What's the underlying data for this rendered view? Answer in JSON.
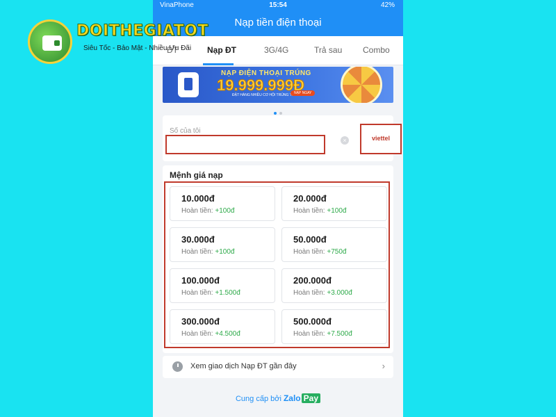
{
  "logo": {
    "brand": "DOITHEGIATOT",
    "slogan": "Siêu Tốc - Bảo Mật - Nhiều Ưu Đãi"
  },
  "status_bar": {
    "carrier": "VinaPhone",
    "time": "15:54",
    "battery": "42%"
  },
  "header": {
    "title": "Nạp tiền điện thoại"
  },
  "tabs": [
    {
      "label": "ĐT",
      "active": false
    },
    {
      "label": "Nạp ĐT",
      "active": true
    },
    {
      "label": "3G/4G",
      "active": false
    },
    {
      "label": "Trả sau",
      "active": false
    },
    {
      "label": "Combo",
      "active": false
    }
  ],
  "banner": {
    "headline": "NẠP ĐIỆN THOẠI TRÚNG",
    "amount": "19.999.999Đ",
    "subtext": "ĐẶT HÀNG NHIỀU CƠ HỘI TRÚNG THƯỞNG",
    "button": "NẠP NGAY"
  },
  "carousel": {
    "pages": 2,
    "active": 1
  },
  "phone_input": {
    "label": "Số của tôi",
    "value": ""
  },
  "carrier": {
    "name": "viettel"
  },
  "denominations": {
    "title": "Mệnh giá nạp",
    "cashback_label": "Hoàn tiền:",
    "items": [
      {
        "amount": "10.000đ",
        "cashback": "+100đ"
      },
      {
        "amount": "20.000đ",
        "cashback": "+100đ"
      },
      {
        "amount": "30.000đ",
        "cashback": "+100đ"
      },
      {
        "amount": "50.000đ",
        "cashback": "+750đ"
      },
      {
        "amount": "100.000đ",
        "cashback": "+1.500đ"
      },
      {
        "amount": "200.000đ",
        "cashback": "+3.000đ"
      },
      {
        "amount": "300.000đ",
        "cashback": "+4.500đ"
      },
      {
        "amount": "500.000đ",
        "cashback": "+7.500đ"
      }
    ]
  },
  "history": {
    "label": "Xem giao dịch Nạp ĐT gần đây"
  },
  "footer": {
    "provided_by": "Cung cấp bởi",
    "zalo": "Zalo",
    "pay": "Pay"
  },
  "colors": {
    "background": "#19e3f1",
    "primary": "#1f8ff6",
    "highlight_border": "#c0392b",
    "cashback": "#2eaa4a"
  }
}
